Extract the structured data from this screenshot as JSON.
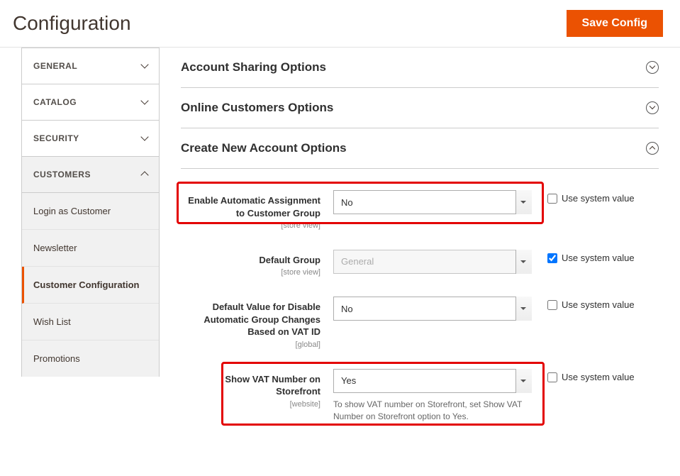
{
  "header": {
    "title": "Configuration",
    "save_label": "Save Config"
  },
  "sidebar": {
    "groups": [
      {
        "label": "GENERAL",
        "expanded": false
      },
      {
        "label": "CATALOG",
        "expanded": false
      },
      {
        "label": "SECURITY",
        "expanded": false
      },
      {
        "label": "CUSTOMERS",
        "expanded": true
      }
    ],
    "customers_items": [
      {
        "label": "Login as Customer",
        "active": false
      },
      {
        "label": "Newsletter",
        "active": false
      },
      {
        "label": "Customer Configuration",
        "active": true
      },
      {
        "label": "Wish List",
        "active": false
      },
      {
        "label": "Promotions",
        "active": false
      }
    ]
  },
  "sections": {
    "acct_sharing": "Account Sharing Options",
    "online_cust": "Online Customers Options",
    "create_acct": "Create New Account Options"
  },
  "fields": {
    "auto_assign": {
      "label": "Enable Automatic Assignment to Customer Group",
      "scope": "[store view]",
      "value": "No",
      "use_system_label": "Use system value",
      "use_system_checked": false
    },
    "default_group": {
      "label": "Default Group",
      "scope": "[store view]",
      "value": "General",
      "use_system_label": "Use system value",
      "use_system_checked": true
    },
    "disable_auto": {
      "label": "Default Value for Disable Automatic Group Changes Based on VAT ID",
      "scope": "[global]",
      "value": "No",
      "use_system_label": "Use system value",
      "use_system_checked": false
    },
    "show_vat": {
      "label": "Show VAT Number on Storefront",
      "scope": "[website]",
      "value": "Yes",
      "note": "To show VAT number on Storefront, set Show VAT Number on Storefront option to Yes.",
      "use_system_label": "Use system value",
      "use_system_checked": false
    }
  }
}
